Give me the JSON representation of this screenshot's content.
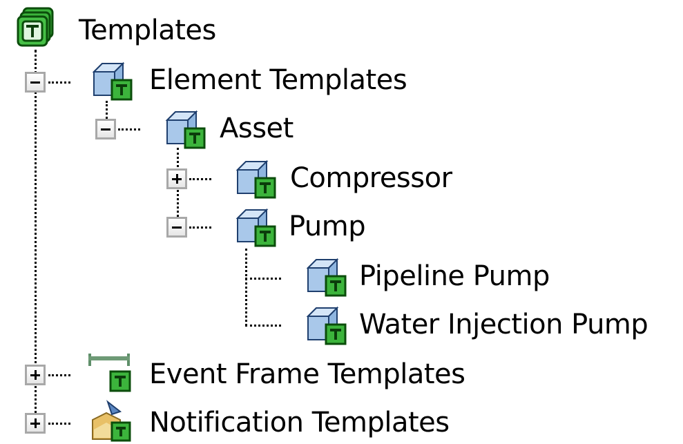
{
  "tree": {
    "root": {
      "label": "Templates",
      "icon": "templates-root-icon"
    },
    "element_templates": {
      "label": "Element Templates",
      "expanded": true
    },
    "asset": {
      "label": "Asset",
      "expanded": true
    },
    "compressor": {
      "label": "Compressor",
      "expanded": false
    },
    "pump": {
      "label": "Pump",
      "expanded": true
    },
    "pipeline_pump": {
      "label": "Pipeline Pump"
    },
    "water_injection_pump": {
      "label": "Water Injection Pump"
    },
    "event_frame_templates": {
      "label": "Event Frame Templates",
      "expanded": false
    },
    "notification_templates": {
      "label": "Notification Templates",
      "expanded": false
    }
  },
  "colors": {
    "template_badge": "#3cb43c",
    "element_cube": "#7fa8d6",
    "expander_border": "#a8a8a8"
  }
}
